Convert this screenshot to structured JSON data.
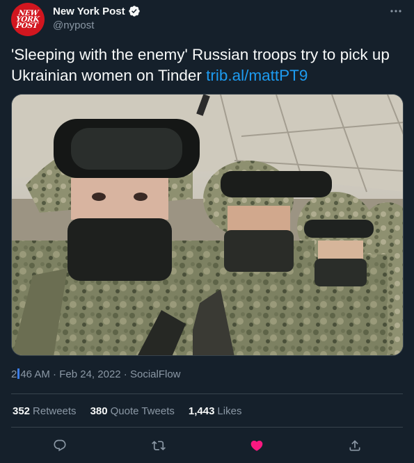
{
  "author": {
    "name": "New York Post",
    "handle": "@nypost",
    "logo_lines": [
      "NEW",
      "YORK",
      "POST"
    ],
    "verified_icon": "verified-badge-icon"
  },
  "tweet": {
    "text": "'Sleeping with the enemy' Russian troops try to pick up Ukrainian women on Tinder ",
    "link": "trib.al/mattPT9"
  },
  "meta": {
    "time_a": "2",
    "time_b": "46 AM",
    "separator": "·",
    "date": "Feb 24, 2022",
    "source": "SocialFlow"
  },
  "stats": {
    "retweets": {
      "count": "352",
      "label": "Retweets"
    },
    "quotes": {
      "count": "380",
      "label": "Quote Tweets"
    },
    "likes": {
      "count": "1,443",
      "label": "Likes"
    }
  },
  "actions": {
    "reply": "reply-icon",
    "retweet": "retweet-icon",
    "like": "heart-icon",
    "share": "share-icon"
  },
  "colors": {
    "background": "#15202b",
    "text": "#f7f9f9",
    "secondary": "#8b98a5",
    "link": "#1d9bf0",
    "like": "#f91880",
    "brand": "#d2161f",
    "divider": "#38444d"
  }
}
